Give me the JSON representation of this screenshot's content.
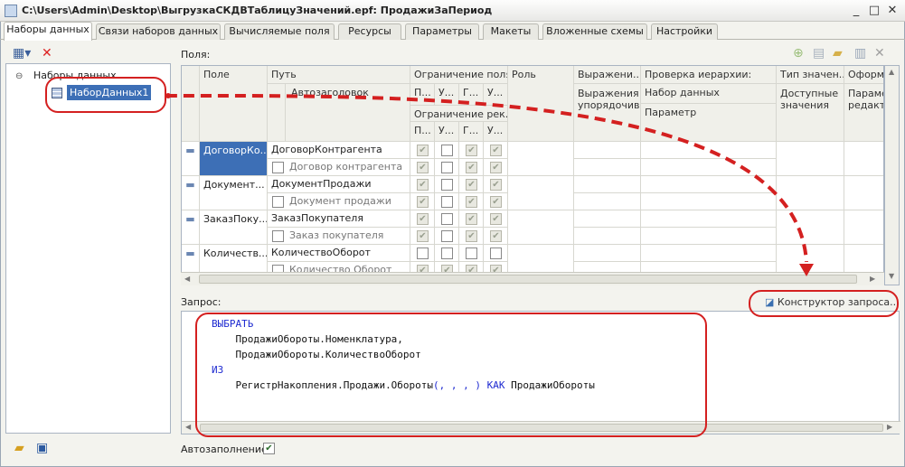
{
  "window": {
    "title": "C:\\Users\\Admin\\Desktop\\ВыгрузкаСКДВТаблицуЗначений.epf: ПродажиЗаПериод",
    "controls": [
      "_",
      "□",
      "✕"
    ]
  },
  "tabs": [
    {
      "label": "Наборы данных",
      "active": true
    },
    {
      "label": "Связи наборов данных",
      "active": false
    },
    {
      "label": "Вычисляемые поля",
      "active": false
    },
    {
      "label": "Ресурсы",
      "active": false
    },
    {
      "label": "Параметры",
      "active": false
    },
    {
      "label": "Макеты",
      "active": false
    },
    {
      "label": "Вложенные схемы",
      "active": false
    },
    {
      "label": "Настройки",
      "active": false
    }
  ],
  "left_panel": {
    "tree_root": "Наборы данных",
    "tree_item": "НаборДанных1",
    "autofill_label": "Автозаполнение",
    "autofill_checked": true
  },
  "fields_panel": {
    "label": "Поля:",
    "columns": {
      "field": "Поле",
      "path": "Путь",
      "title": "Автозаголовок",
      "restriction": "Ограничение поля",
      "restriction_sub": [
        "П...",
        "У...",
        "Г...",
        "У..."
      ],
      "restriction_req": "Ограничение рек...",
      "restriction_req_sub": [
        "П...",
        "У...",
        "Г...",
        "У..."
      ],
      "role": "Роль",
      "expression": "Выражени...",
      "expression2": "Выражения упорядочив...",
      "hierarchy": "Проверка иерархии:",
      "hierarchy_set": "Набор данных",
      "hierarchy_param": "Параметр",
      "value_type": "Тип значен...",
      "available_values": "Доступные значения",
      "format": "Оформ...",
      "format2": "Параме редакт"
    },
    "rows": [
      {
        "field": "ДоговорКо...",
        "path": "ДоговорКонтрагента",
        "title": "Договор контрагента",
        "restrict": [
          true,
          false,
          true,
          true
        ],
        "restrict2": [
          true,
          false,
          true,
          true
        ]
      },
      {
        "field": "Документ...",
        "path": "ДокументПродажи",
        "title": "Документ продажи",
        "restrict": [
          true,
          false,
          true,
          true
        ],
        "restrict2": [
          true,
          false,
          true,
          true
        ]
      },
      {
        "field": "ЗаказПоку...",
        "path": "ЗаказПокупателя",
        "title": "Заказ покупателя",
        "restrict": [
          true,
          false,
          true,
          true
        ],
        "restrict2": [
          true,
          false,
          true,
          true
        ]
      },
      {
        "field": "Количеств...",
        "path": "КоличествоОборот",
        "title": "Количество Оборот",
        "restrict": [
          false,
          false,
          false,
          false
        ],
        "restrict2": [
          true,
          true,
          true,
          true
        ]
      }
    ]
  },
  "query_panel": {
    "label": "Запрос:",
    "constructor_button": "Конструктор запроса...",
    "lines": [
      {
        "indent": "",
        "parts": [
          {
            "t": "ВЫБРАТЬ",
            "kw": true
          }
        ]
      },
      {
        "indent": "    ",
        "parts": [
          {
            "t": "ПродажиОбороты.Номенклатура,",
            "kw": false
          }
        ]
      },
      {
        "indent": "    ",
        "parts": [
          {
            "t": "ПродажиОбороты.КоличествоОборот",
            "kw": false
          }
        ]
      },
      {
        "indent": "",
        "parts": [
          {
            "t": "ИЗ",
            "kw": true
          }
        ]
      },
      {
        "indent": "    ",
        "parts": [
          {
            "t": "РегистрНакопления.Продажи.Обороты",
            "kw": false
          },
          {
            "t": "(, , , )",
            "kw": true
          },
          {
            "t": " ",
            "kw": false
          },
          {
            "t": "КАК",
            "kw": true
          },
          {
            "t": " ПродажиОбороты",
            "kw": false
          }
        ]
      }
    ]
  },
  "colors": {
    "annotation": "#d42020",
    "keyword": "#1f2bd1",
    "selection": "#3d6fb6"
  }
}
